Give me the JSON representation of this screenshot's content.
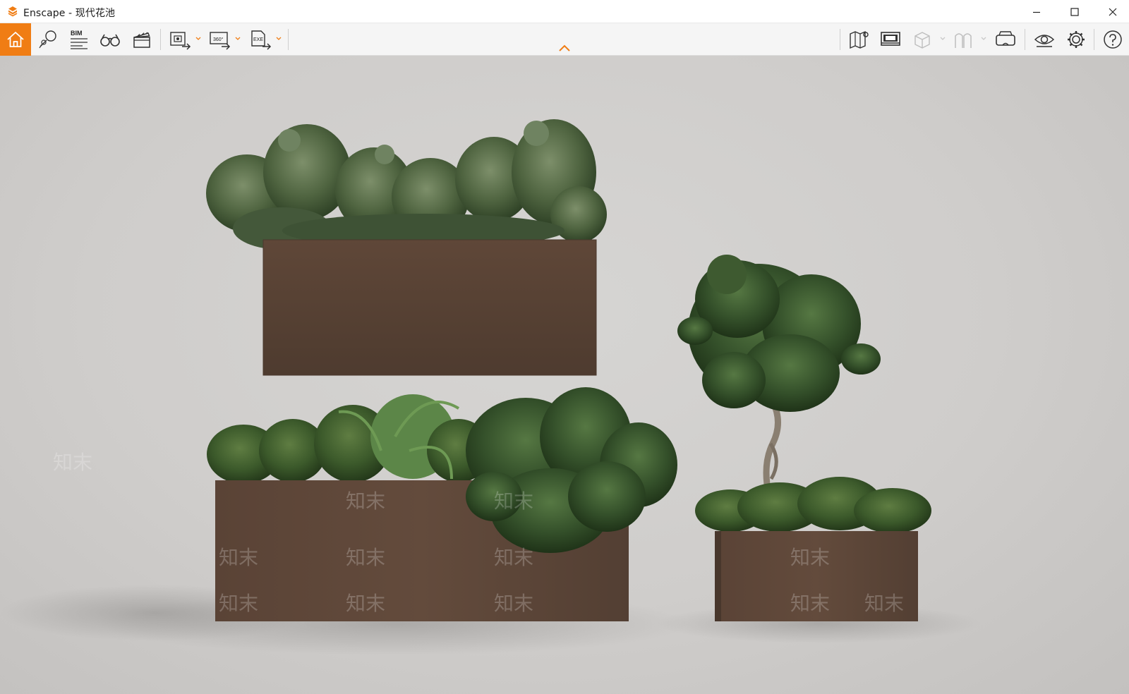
{
  "window": {
    "title": "Enscape - 现代花池",
    "controls": [
      "minimize",
      "maximize",
      "close"
    ]
  },
  "toolbar": {
    "left_items": [
      {
        "name": "home-icon",
        "active": true
      },
      {
        "name": "views-icon"
      },
      {
        "name": "bim-icon",
        "label": "BIM"
      },
      {
        "name": "binoculars-icon"
      },
      {
        "name": "clapperboard-icon"
      },
      {
        "name": "screenshot-export-icon"
      },
      {
        "name": "panorama-export-icon",
        "label": "360°"
      },
      {
        "name": "exe-export-icon",
        "label": "EXE"
      }
    ],
    "right_items": [
      {
        "name": "map-icon"
      },
      {
        "name": "monitor-icon"
      },
      {
        "name": "cube-icon",
        "disabled": true
      },
      {
        "name": "walk-icon",
        "disabled": true
      },
      {
        "name": "vr-headset-icon"
      },
      {
        "name": "eye-icon"
      },
      {
        "name": "gear-icon"
      },
      {
        "name": "help-icon"
      }
    ],
    "accent": "#f07d14"
  },
  "viewport": {
    "scene": "modern planter render",
    "watermark": "知末",
    "background_color": "#d0cfcd",
    "planter_color": "#5e4638",
    "foliage_color": "#3f5a33"
  }
}
